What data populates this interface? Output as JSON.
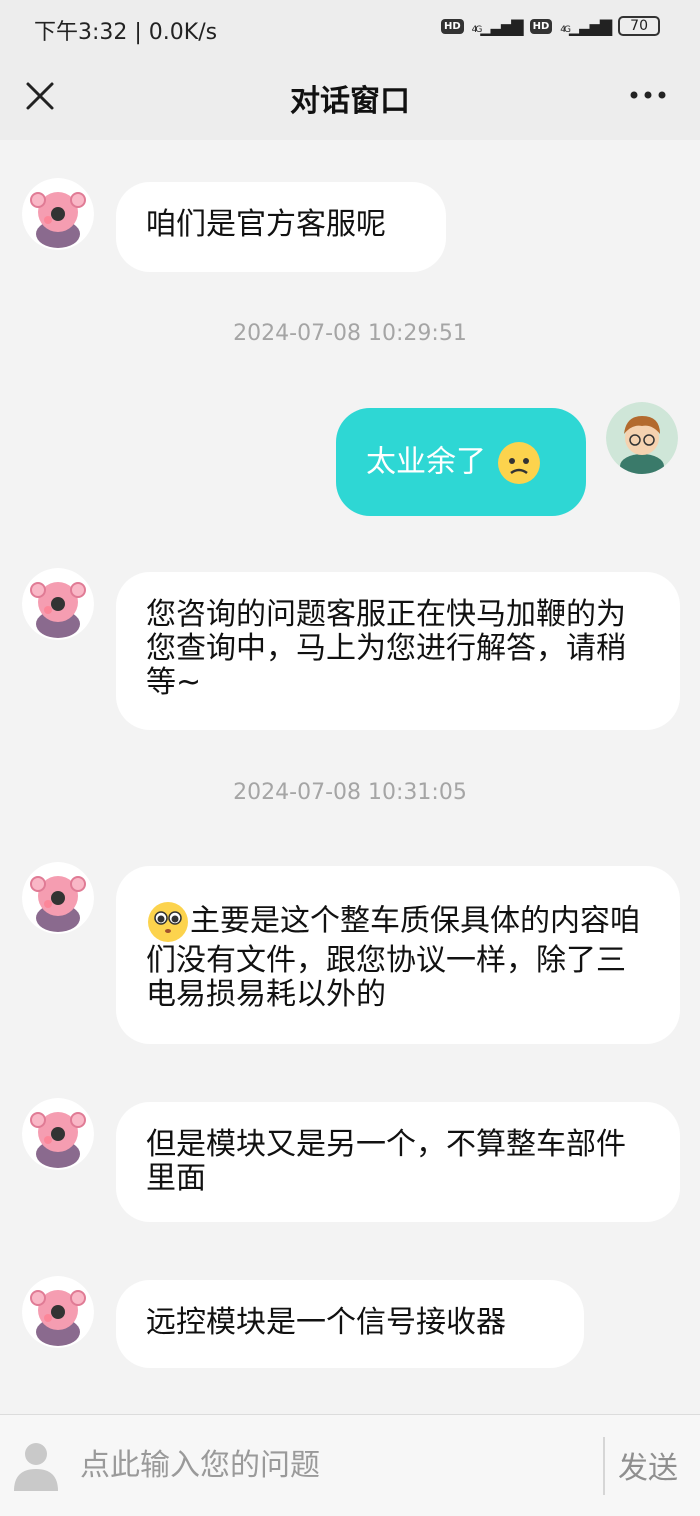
{
  "status_bar": {
    "time": "下午3:32 | 0.0K/s",
    "network1": "HD",
    "network2": "HD",
    "signal_label": "4G",
    "battery": "70"
  },
  "header": {
    "title": "对话窗口",
    "close_icon": "close-icon",
    "more_icon": "more-icon"
  },
  "messages": [
    {
      "side": "left",
      "text": "咱们是官方客服呢"
    },
    {
      "side": "time",
      "text": "2024-07-08 10:29:51"
    },
    {
      "side": "right",
      "text": "太业余了",
      "emoji": "worried-face"
    },
    {
      "side": "left",
      "text": "您咨询的问题客服正在快马加鞭的为您查询中，马上为您进行解答，请稍等~"
    },
    {
      "side": "time",
      "text": "2024-07-08 10:31:05"
    },
    {
      "side": "left",
      "text": "主要是这个整车质保具体的内容咱们没有文件，跟您协议一样，除了三电易损易耗以外的",
      "emoji": "pleading-face"
    },
    {
      "side": "left",
      "text": "但是模块又是另一个，不算整车部件里面"
    },
    {
      "side": "left",
      "text": "远控模块是一个信号接收器"
    }
  ],
  "input": {
    "placeholder": "点此输入您的问题",
    "send_label": "发送"
  },
  "colors": {
    "accent": "#2ed7d4",
    "background": "#f3f3f3",
    "header": "#ededed"
  }
}
